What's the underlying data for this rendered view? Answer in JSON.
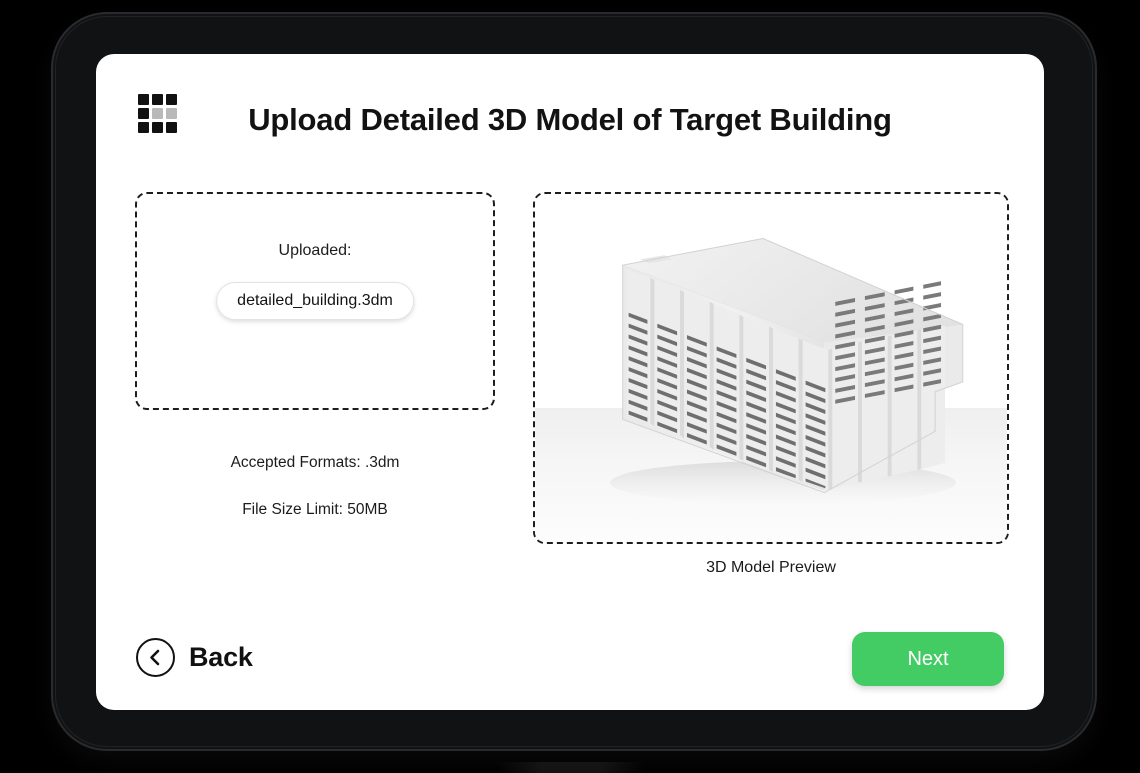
{
  "device": {
    "type": "tablet",
    "bezel_color": "#111214",
    "background_color": "#000000"
  },
  "header": {
    "icon": "grid-3x3-icon",
    "title": "Upload Detailed 3D Model of Target Building"
  },
  "upload": {
    "label": "Uploaded:",
    "file_name": "detailed_building.3dm",
    "accepted_formats": "Accepted Formats: .3dm",
    "file_size_limit": "File Size Limit: 50MB"
  },
  "preview": {
    "caption": "3D Model Preview",
    "model_description": "white massing render of a long multi-storey residential slab building",
    "background_color": "#ffffff",
    "ground_color": "#efefef"
  },
  "footer": {
    "back_label": "Back",
    "back_icon": "chevron-left-circle-icon",
    "next_label": "Next",
    "next_color": "#43cc63"
  }
}
